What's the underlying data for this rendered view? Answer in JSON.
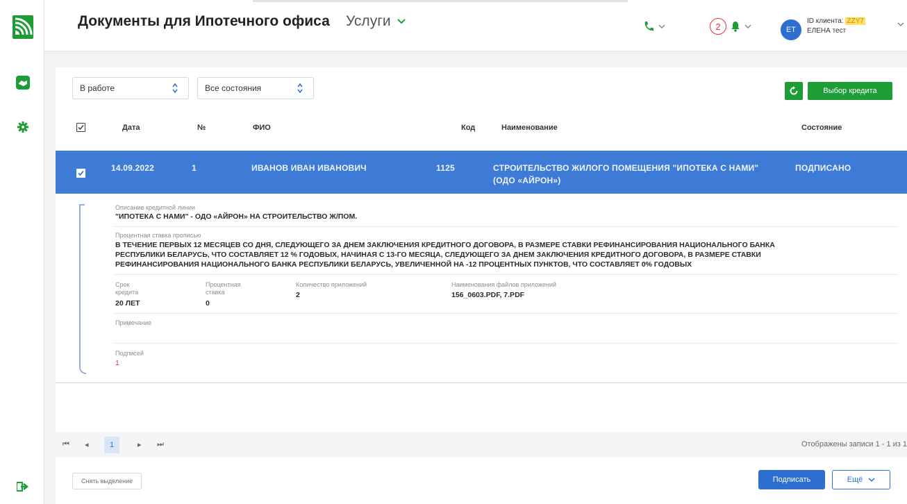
{
  "header": {
    "title": "Документы для Ипотечного офиса",
    "services_label": "Услуги",
    "notifications_count": "2",
    "avatar_initials": "ЕТ",
    "client_id_label": "ID клиента:",
    "client_id_value": "ZZY7",
    "user_name": "ЕЛЕНА тест"
  },
  "filters": {
    "status_value": "В работе",
    "state_value": "Все состояния"
  },
  "actions": {
    "select_credit_label": "Выбор кредита"
  },
  "table": {
    "columns": [
      "Дата",
      "№",
      "ФИО",
      "Код",
      "Наименование",
      "Состояние"
    ],
    "rows": [
      {
        "date": "14.09.2022",
        "num": "1",
        "fio": "ИВАНОВ ИВАН ИВАНОВИЧ",
        "code": "1125",
        "name_line1": "СТРОИТЕЛЬСТВО ЖИЛОГО ПОМЕЩЕНИЯ \"ИПОТЕКА С НАМИ\"",
        "name_line2": "(ОДО «АЙРОН»)",
        "state": "ПОДПИСАНО"
      }
    ]
  },
  "details": {
    "credit_line_label": "Описание кредитной линии",
    "credit_line_value": "\"ИПОТЕКА С НАМИ\" - ОДО «АЙРОН» НА СТРОИТЕЛЬСТВО Ж/ПОМ.",
    "rate_words_label": "Процентная ставка прописью",
    "rate_words_line1": "В ТЕЧЕНИЕ ПЕРВЫХ 12 МЕСЯЦЕВ СО ДНЯ, СЛЕДУЮЩЕГО ЗА ДНЕМ ЗАКЛЮЧЕНИЯ КРЕДИТНОГО ДОГОВОРА, В РАЗМЕРЕ СТАВКИ РЕФИНАНСИРОВАНИЯ НАЦИОНАЛЬНОГО БАНКА",
    "rate_words_line2": "РЕСПУБЛИКИ БЕЛАРУСЬ, ЧТО СОСТАВЛЯЕТ 12 % ГОДОВЫХ, НАЧИНАЯ С 13-ГО МЕСЯЦА, СЛЕДУЮЩЕГО ЗА ДНЕМ ЗАКЛЮЧЕНИЯ КРЕДИТНОГО ДОГОВОРА, В РАЗМЕРЕ СТАВКИ",
    "rate_words_line3": "РЕФИНАНСИРОВАНИЯ НАЦИОНАЛЬНОГО БАНКА РЕСПУБЛИКИ БЕЛАРУСЬ, УВЕЛИЧЕННОЙ НА -12 ПРОЦЕНТНЫХ ПУНКТОВ, ЧТО СОСТАВЛЯЕТ 0% ГОДОВЫХ",
    "term_label_1": "Срок",
    "term_label_2": "кредита",
    "term_value": "20 ЛЕТ",
    "rate_label_1": "Процентная",
    "rate_label_2": "ставка",
    "rate_value": "0",
    "attach_count_label": "Количество приложений",
    "attach_count_value": "2",
    "files_label": "Наименования файлов приложений",
    "files_value": "156_0603.PDF, 7.PDF",
    "note_label": "Примечание",
    "signatures_label": "Подписей",
    "signatures_value": "1"
  },
  "pager": {
    "current_page": "1",
    "info": "Отображены записи 1 - 1 из 1"
  },
  "footer": {
    "clear_selection_label": "Снять выделение",
    "sign_label": "Подписать",
    "more_label": "Ещё"
  },
  "colors": {
    "brand_green": "#1e9c36",
    "selected_row": "#3d7bd6",
    "primary_blue": "#2d6fd1",
    "alert_red": "#e0323a"
  }
}
